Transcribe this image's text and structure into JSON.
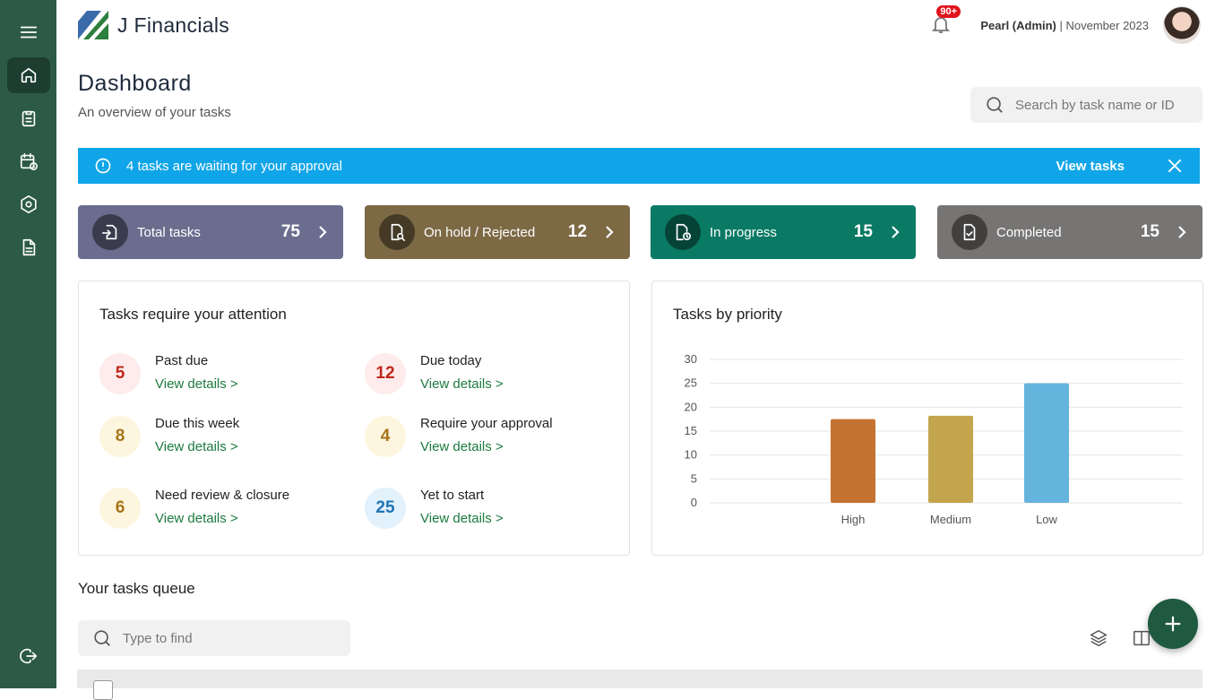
{
  "app": {
    "name": "J Financials"
  },
  "user": {
    "name": "Pearl (Admin)",
    "separator": " | ",
    "period": "November 2023",
    "notification_badge": "90+"
  },
  "sidebar": {
    "items": [
      {
        "icon": "menu-icon"
      },
      {
        "icon": "home-icon",
        "active": true
      },
      {
        "icon": "clipboard-icon"
      },
      {
        "icon": "calendar-clock-icon"
      },
      {
        "icon": "settings-hex-icon"
      },
      {
        "icon": "document-icon"
      },
      {
        "icon": "logout-icon"
      }
    ]
  },
  "header": {
    "title": "Dashboard",
    "subtitle": "An overview of your tasks",
    "search_placeholder": "Search by task name or ID"
  },
  "banner": {
    "text": "4 tasks are waiting for your approval",
    "link": "View tasks",
    "color": "#10a5e8"
  },
  "stats": [
    {
      "label": "Total tasks",
      "count": "75",
      "color": "#6b6d8f"
    },
    {
      "label": "On hold / Rejected",
      "count": "12",
      "color": "#7d6a45"
    },
    {
      "label": "In progress",
      "count": "15",
      "color": "#0b7a64"
    },
    {
      "label": "Completed",
      "count": "15",
      "color": "#777574"
    }
  ],
  "attention": {
    "title": "Tasks require your attention",
    "link_label": "View details >",
    "items": [
      {
        "count": "5",
        "label": "Past due"
      },
      {
        "count": "12",
        "label": "Due today"
      },
      {
        "count": "8",
        "label": "Due this week"
      },
      {
        "count": "4",
        "label": "Require your approval"
      },
      {
        "count": "6",
        "label": "Need review & closure"
      },
      {
        "count": "25",
        "label": "Yet to start"
      }
    ]
  },
  "priority": {
    "title": "Tasks by priority"
  },
  "chart_data": {
    "type": "bar",
    "title": "Tasks by priority",
    "categories": [
      "High",
      "Medium",
      "Low"
    ],
    "values": [
      17.5,
      18.2,
      25
    ],
    "colors": [
      "#c47230",
      "#c2a54c",
      "#64b4de"
    ],
    "ylim": [
      0,
      30
    ],
    "yticks": [
      0,
      5,
      10,
      15,
      20,
      25,
      30
    ],
    "grid": true
  },
  "queue": {
    "title": "Your tasks queue",
    "search_placeholder": "Type to find"
  }
}
